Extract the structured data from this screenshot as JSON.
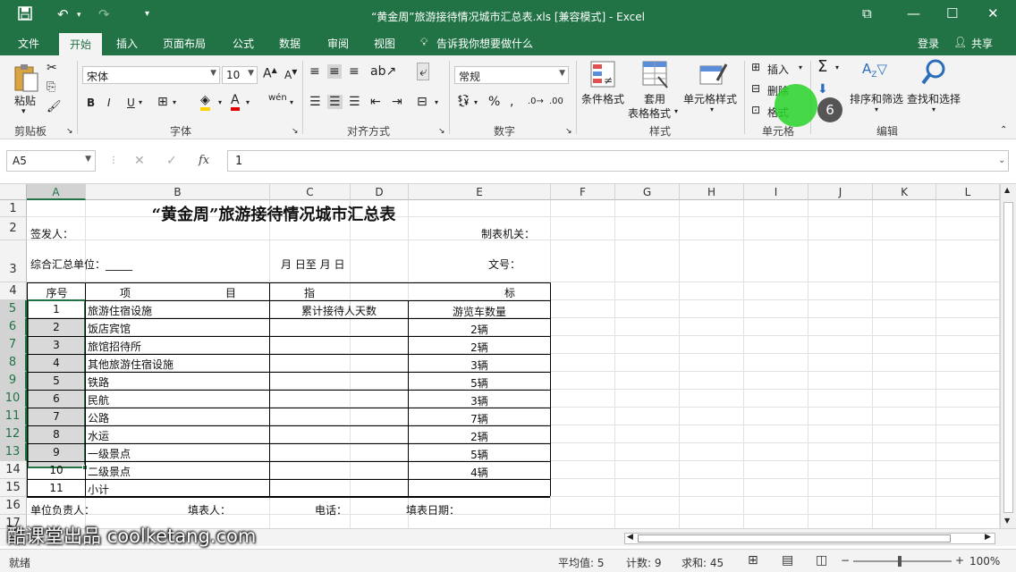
{
  "titlebar": {
    "title": "“黄金周”旅游接待情况城市汇总表.xls  [兼容模式] - Excel",
    "save_icon": "save-icon",
    "undo_icon": "undo-icon",
    "redo_icon": "redo-icon"
  },
  "tabs": [
    "文件",
    "开始",
    "插入",
    "页面布局",
    "公式",
    "数据",
    "审阅",
    "视图"
  ],
  "tell_me": "告诉我你想要做什么",
  "login": "登录",
  "share": "共享",
  "ribbon": {
    "clipboard": {
      "paste": "粘贴",
      "label": "剪贴板"
    },
    "font": {
      "name": "宋体",
      "size": "10",
      "label": "字体",
      "bold": "B",
      "italic": "I",
      "underline": "U"
    },
    "alignment": {
      "label": "对齐方式"
    },
    "number": {
      "format": "常规",
      "label": "数字",
      "percent": "%"
    },
    "styles": {
      "cond": "条件格式",
      "table1": "套用",
      "table2": "表格格式",
      "cell": "单元格样式",
      "label": "样式"
    },
    "cells": {
      "insert": "插入",
      "delete": "删除",
      "format": "格式",
      "label": "单元格"
    },
    "editing": {
      "sort": "排序和筛选",
      "find": "查找和选择",
      "label": "编辑"
    },
    "step_badge": "6"
  },
  "formula_bar": {
    "name_box": "A5",
    "fx": "fx",
    "value": "1"
  },
  "columns": [
    "A",
    "B",
    "C",
    "D",
    "E",
    "F",
    "G",
    "H",
    "I",
    "J",
    "K",
    "L"
  ],
  "rows": [
    "1",
    "2",
    "3",
    "4",
    "5",
    "6",
    "7",
    "8",
    "9",
    "10",
    "11",
    "12",
    "13",
    "14",
    "15",
    "16",
    "17"
  ],
  "sheet": {
    "title": "“黄金周”旅游接待情况城市汇总表",
    "signer": "签发人：",
    "org": "制表机关：",
    "unit": "综合汇总单位：_____",
    "date_range": "月  日至   月  日",
    "doc_no": "文号：",
    "hdr_no": "序号",
    "hdr_item1": "项",
    "hdr_item2": "目",
    "hdr_ind1": "指",
    "hdr_ind2": "标",
    "hdr_days": "累计接待人天数",
    "hdr_bus": "游览车数量",
    "items": [
      {
        "no": "1",
        "name": "旅游住宿设施",
        "bus": ""
      },
      {
        "no": "2",
        "name": "饭店宾馆",
        "bus": "2辆"
      },
      {
        "no": "3",
        "name": "旅馆招待所",
        "bus": "2辆"
      },
      {
        "no": "4",
        "name": "其他旅游住宿设施",
        "bus": "3辆"
      },
      {
        "no": "5",
        "name": "铁路",
        "bus": "5辆"
      },
      {
        "no": "6",
        "name": "民航",
        "bus": "3辆"
      },
      {
        "no": "7",
        "name": "公路",
        "bus": "7辆"
      },
      {
        "no": "8",
        "name": "水运",
        "bus": "2辆"
      },
      {
        "no": "9",
        "name": "一级景点",
        "bus": "5辆"
      },
      {
        "no": "10",
        "name": "二级景点",
        "bus": "4辆"
      },
      {
        "no": "11",
        "name": "小计",
        "bus": ""
      }
    ],
    "footer_head": "单位负责人：",
    "footer_filler": "填表人：",
    "footer_phone": "电话：",
    "footer_date": "填表日期："
  },
  "watermark": "酷课堂出品 coolketang.com",
  "status": {
    "ready": "就绪",
    "average": "平均值: 5",
    "count": "计数: 9",
    "sum": "求和: 45",
    "zoom": "100%"
  }
}
